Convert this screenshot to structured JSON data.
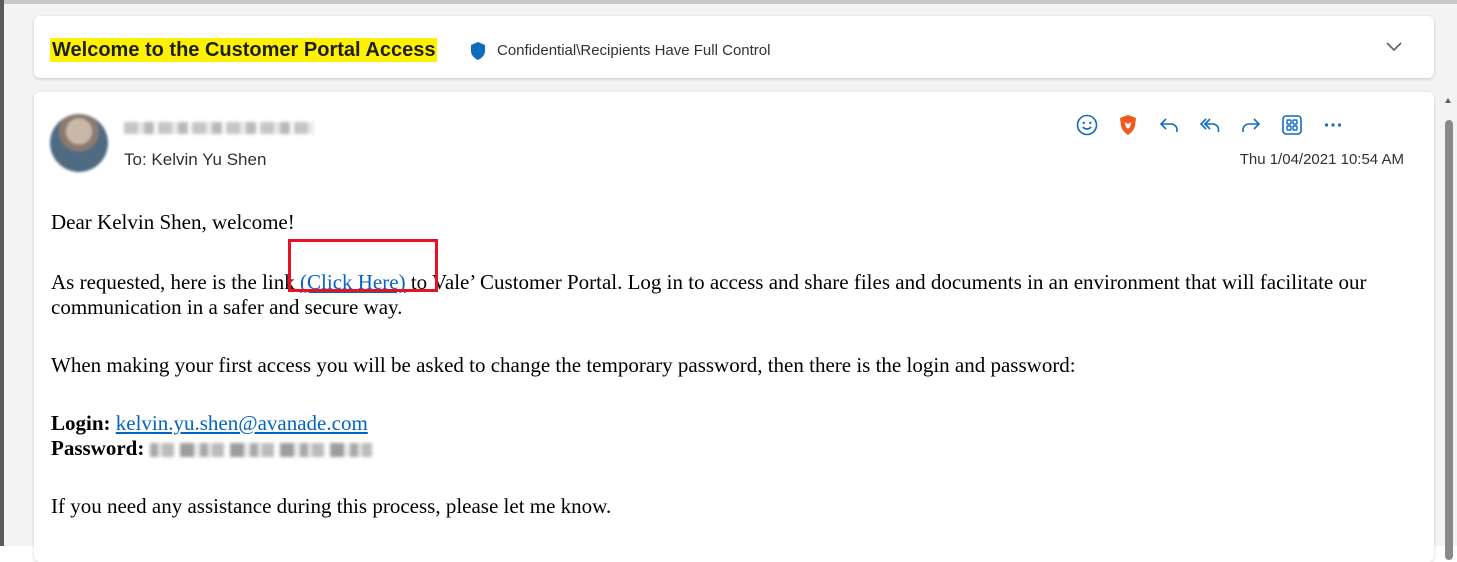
{
  "subject": {
    "title": "Welcome to the Customer Portal Access",
    "sensitivity_label": "Confidential\\Recipients Have Full Control"
  },
  "message": {
    "to_line": "To:  Kelvin Yu Shen",
    "date": "Thu 1/04/2021 10:54 AM",
    "actions": [
      "smiley-icon",
      "brave-shield-icon",
      "reply-icon",
      "reply-all-icon",
      "forward-icon",
      "apps-icon",
      "more-icon"
    ]
  },
  "body": {
    "greeting": "Dear Kelvin Shen, welcome!",
    "p1_before": "As requested, here is the link ",
    "p1_link": "(Click Here)",
    "p1_after": " to Vale’ Customer Portal. Log in to access and share files and documents in an environment that will facilitate our communication in a safer and secure way.",
    "p2": "When making your first access you will be asked to change the temporary password, then there is the login and password:",
    "login_label": "Login:",
    "login_value": "kelvin.yu.shen@avanade.com",
    "password_label": "Password:",
    "p3": "If you need any assistance during this process, please let me know."
  },
  "colors": {
    "highlight": "#fff200",
    "link": "#0563c1",
    "outline": "#e81123",
    "accent": "#0f6cbd"
  }
}
